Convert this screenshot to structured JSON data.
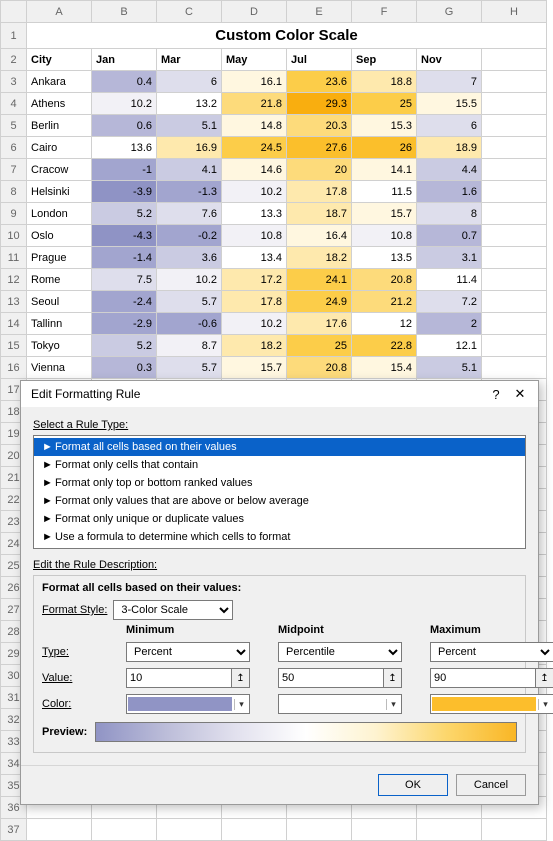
{
  "columns": [
    "A",
    "B",
    "C",
    "D",
    "E",
    "F",
    "G",
    "H"
  ],
  "title": "Custom Color Scale",
  "headers_row": 2,
  "headers": [
    "City",
    "Jan",
    "Mar",
    "May",
    "Jul",
    "Sep",
    "Nov"
  ],
  "data_colors": {
    "scale": [
      "#8f93c5",
      "#a2a5cf",
      "#b6b7d8",
      "#cacbe2",
      "#dedeec",
      "#f2f1f6",
      "#ffffff",
      "#fff7e0",
      "#fee9ad",
      "#fddb7b",
      "#fccd49",
      "#fbbf2b",
      "#f9ae0f"
    ]
  },
  "chart_data": {
    "type": "table",
    "title": "Custom Color Scale",
    "columns": [
      "City",
      "Jan",
      "Mar",
      "May",
      "Jul",
      "Sep",
      "Nov"
    ],
    "rows": [
      [
        "Ankara",
        0.4,
        6,
        16.1,
        23.6,
        18.8,
        7
      ],
      [
        "Athens",
        10.2,
        13.2,
        21.8,
        29.3,
        25,
        15.5
      ],
      [
        "Berlin",
        0.6,
        5.1,
        14.8,
        20.3,
        15.3,
        6
      ],
      [
        "Cairo",
        13.6,
        16.9,
        24.5,
        27.6,
        26,
        18.9
      ],
      [
        "Cracow",
        -1,
        4.1,
        14.6,
        20,
        14.1,
        4.4
      ],
      [
        "Helsinki",
        -3.9,
        -1.3,
        10.2,
        17.8,
        11.5,
        1.6
      ],
      [
        "London",
        5.2,
        7.6,
        13.3,
        18.7,
        15.7,
        8
      ],
      [
        "Oslo",
        -4.3,
        -0.2,
        10.8,
        16.4,
        10.8,
        0.7
      ],
      [
        "Prague",
        -1.4,
        3.6,
        13.4,
        18.2,
        13.5,
        3.1
      ],
      [
        "Rome",
        7.5,
        10.2,
        17.2,
        24.1,
        20.8,
        11.4
      ],
      [
        "Seoul",
        -2.4,
        5.7,
        17.8,
        24.9,
        21.2,
        7.2
      ],
      [
        "Tallinn",
        -2.9,
        -0.6,
        10.2,
        17.6,
        12,
        2
      ],
      [
        "Tokyo",
        5.2,
        8.7,
        18.2,
        25,
        22.8,
        12.1
      ],
      [
        "Vienna",
        0.3,
        5.7,
        15.7,
        20.8,
        15.4,
        5.1
      ]
    ]
  },
  "dialog": {
    "title": "Edit Formatting Rule",
    "help_icon": "?",
    "close_icon": "✕",
    "select_label": "Select a Rule Type:",
    "rule_types": [
      "Format all cells based on their values",
      "Format only cells that contain",
      "Format only top or bottom ranked values",
      "Format only values that are above or below average",
      "Format only unique or duplicate values",
      "Use a formula to determine which cells to format"
    ],
    "selected_rule_index": 0,
    "edit_label": "Edit the Rule Description:",
    "desc_heading": "Format all cells based on their values:",
    "format_style_label": "Format Style:",
    "format_style_value": "3-Color Scale",
    "cols": [
      "Minimum",
      "Midpoint",
      "Maximum"
    ],
    "row_type_label": "Type:",
    "row_value_label": "Value:",
    "row_color_label": "Color:",
    "types": [
      "Percent",
      "Percentile",
      "Percent"
    ],
    "values": [
      "10",
      "50",
      "90"
    ],
    "colors": [
      "#9094c5",
      "#ffffff",
      "#fcbe2c"
    ],
    "preview_label": "Preview:",
    "ok": "OK",
    "cancel": "Cancel"
  }
}
